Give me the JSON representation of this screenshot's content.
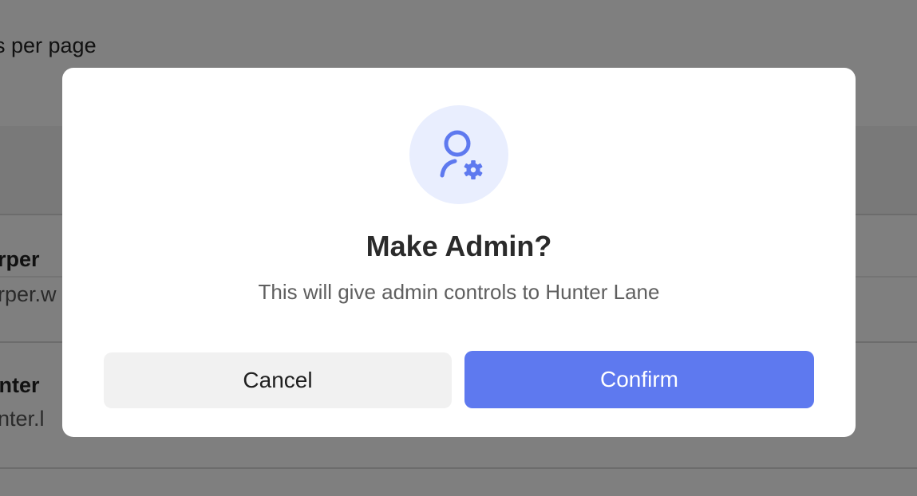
{
  "background": {
    "per_page_text": "s per page",
    "rows": [
      {
        "name": "arper",
        "email": "arper.w"
      },
      {
        "name": "unter",
        "email": "unter.l"
      }
    ]
  },
  "dialog": {
    "icon": "user-gear-icon",
    "title": "Make Admin?",
    "message": "This will give admin controls to Hunter Lane",
    "cancel_label": "Cancel",
    "confirm_label": "Confirm"
  },
  "colors": {
    "accent": "#5e79ef",
    "icon_bg": "#e9eefe",
    "overlay": "rgba(0,0,0,0.5)"
  }
}
